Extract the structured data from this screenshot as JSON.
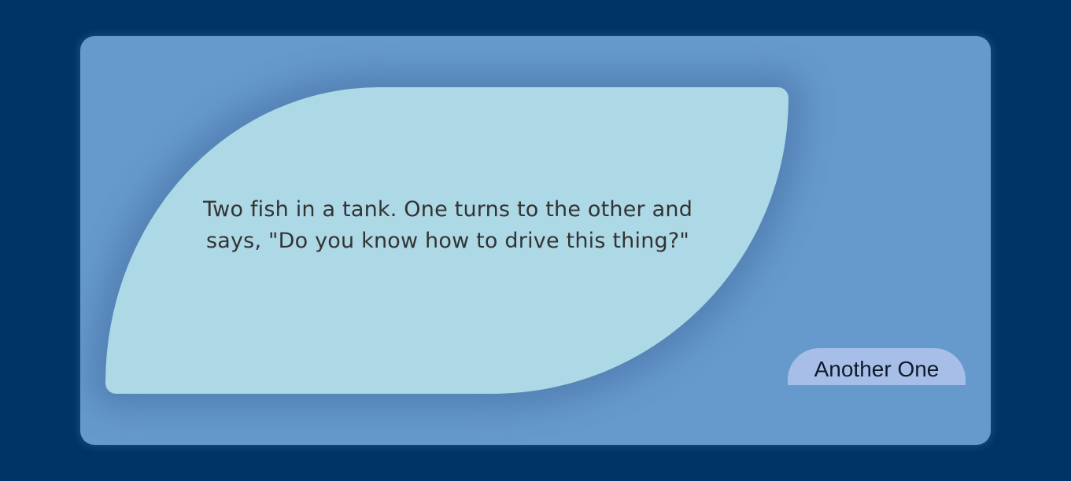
{
  "joke": {
    "text": "Two fish in a tank. One turns to the other and says, \"Do you know how to drive this thing?\""
  },
  "actions": {
    "another_label": "Another One"
  },
  "colors": {
    "page_background": "#003366",
    "card_background": "#6699cc",
    "bubble_background": "#add8e6",
    "button_background": "#a7bfe8",
    "text": "#333333"
  }
}
